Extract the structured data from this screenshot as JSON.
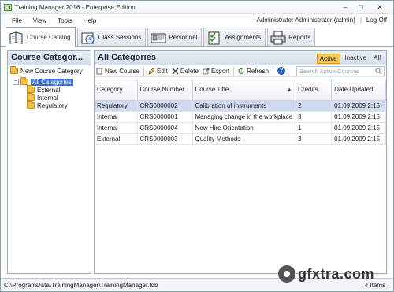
{
  "window": {
    "title": "Training Manager 2016 - Enterprise Edition",
    "minimize": "–",
    "maximize": "□",
    "close": "✕"
  },
  "menu": {
    "items": [
      "File",
      "View",
      "Tools",
      "Help"
    ],
    "user": "Administrator Administrator (admin)",
    "separator": "|",
    "logoff": "Log Off"
  },
  "tabs": [
    {
      "label": "Course Catalog",
      "icon": "book-icon",
      "active": true
    },
    {
      "label": "Class Sessions",
      "icon": "clock-icon",
      "active": false
    },
    {
      "label": "Personnel",
      "icon": "id-card-icon",
      "active": false
    },
    {
      "label": "Assignments",
      "icon": "checklist-icon",
      "active": false
    },
    {
      "label": "Reports",
      "icon": "printer-icon",
      "active": false
    }
  ],
  "sidebar": {
    "title": "Course Categor...",
    "new_category": "New Course Category",
    "tree": {
      "root": "All Categories",
      "toggle": "−",
      "children": [
        "External",
        "Internal",
        "Regulatory"
      ]
    }
  },
  "main": {
    "title": "All Categories",
    "filters": [
      "Active",
      "Inactive",
      "All"
    ],
    "active_filter": "Active",
    "toolbar": {
      "new": "New Course",
      "edit": "Edit",
      "delete": "Delete",
      "export": "Export",
      "refresh": "Refresh",
      "help": "?"
    },
    "search_placeholder": "Search Active Courses",
    "columns": [
      "Category",
      "Course Number",
      "Course Title",
      "Credits",
      "Date Updated"
    ],
    "sort_indicator": "▲",
    "rows": [
      {
        "category": "Regulatory",
        "number": "CRS0000002",
        "title": "Calibration of instruments",
        "credits": "2",
        "date": "01.09.2009 2:15",
        "selected": true
      },
      {
        "category": "Internal",
        "number": "CRS0000001",
        "title": "Managing change in the workplace",
        "credits": "3",
        "date": "01.09.2009 2:15",
        "selected": false
      },
      {
        "category": "Internal",
        "number": "CRS0000004",
        "title": "New Hire Orientation",
        "credits": "1",
        "date": "01.09.2009 2:15",
        "selected": false
      },
      {
        "category": "External",
        "number": "CRS0000003",
        "title": "Quality Methods",
        "credits": "3",
        "date": "01.09.2009 2:15",
        "selected": false
      }
    ]
  },
  "status": {
    "path": "C:\\ProgramData\\TrainingManager\\TrainingManager.tdb",
    "count": "4 Items"
  },
  "watermark": "gfxtra.com",
  "colors": {
    "selection": "#3d6dcc",
    "active_filter": "#f6c75a",
    "row_selected": "#cfdcf0",
    "pane_header": "#d5dee9"
  }
}
